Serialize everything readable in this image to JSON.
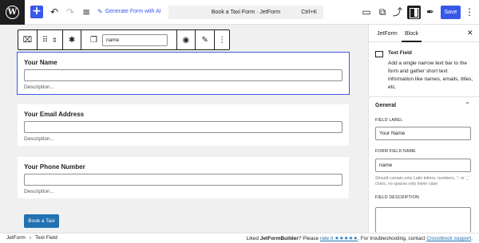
{
  "topbar": {
    "generate_label": "Generate Form with AI",
    "doc_title": "Book a Taxi Form · JetForm",
    "shortcut": "Ctrl+K",
    "save_label": "Save"
  },
  "toolbar": {
    "name_value": "name"
  },
  "form": {
    "fields": [
      {
        "label": "Your Name",
        "description": "Description..."
      },
      {
        "label": "Your Email Address",
        "description": "Description..."
      },
      {
        "label": "Your Phone Number",
        "description": "Description..."
      }
    ],
    "submit_label": "Book a Taxi"
  },
  "sidebar": {
    "tabs": [
      "JetForm",
      "Block"
    ],
    "active_tab": "Block",
    "block_title": "Text Field",
    "block_desc": "Add a single narrow text bar to the form and gather short text information like names, emails, titles, etc.",
    "section_title": "General",
    "field_label_label": "FIELD LABEL",
    "field_label_value": "Your Name",
    "form_field_name_label": "FORM FIELD NAME",
    "form_field_name_value": "name",
    "help_text": "Should contain only Latin letters, numbers, '-' or '_' chars, no spaces only lower case",
    "field_desc_label": "FIELD DESCRIPTION"
  },
  "footer": {
    "crumbs": [
      "JetForm",
      "›",
      "Text Field"
    ],
    "note_prefix": "Liked ",
    "note_brand": "JetFormBuilder",
    "note_mid": "? Please ",
    "note_rate": "rate it ★★★★★",
    "note_after": ". For troubleshooting, contact ",
    "note_support": "Crocoblock support",
    "note_end": "."
  },
  "colors": {
    "accent": "#3858e9",
    "button_blue": "#2271b1"
  }
}
